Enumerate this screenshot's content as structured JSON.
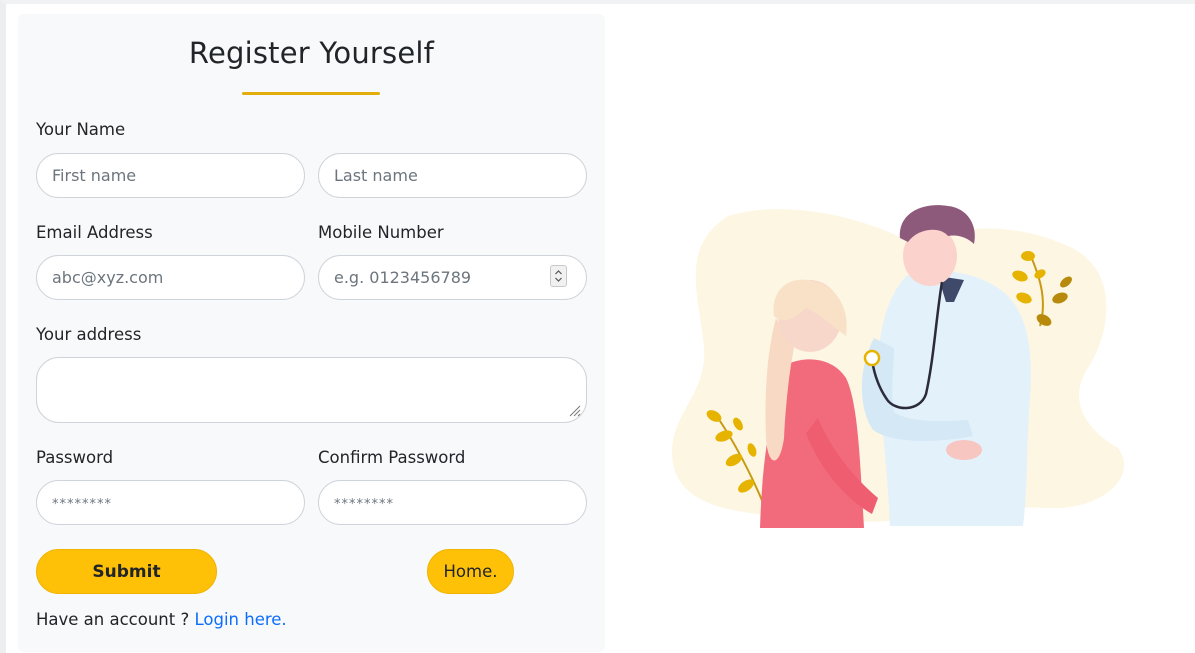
{
  "form": {
    "title": "Register Yourself",
    "name_label": "Your Name",
    "first_name_placeholder": "First name",
    "last_name_placeholder": "Last name",
    "email_label": "Email Address",
    "email_placeholder": "abc@xyz.com",
    "mobile_label": "Mobile Number",
    "mobile_placeholder": "e.g. 0123456789",
    "address_label": "Your address",
    "password_label": "Password",
    "password_placeholder": "********",
    "confirm_password_label": "Confirm Password",
    "confirm_password_placeholder": "********",
    "submit_label": "Submit",
    "home_label": "Home.",
    "account_prompt": "Have an account ? ",
    "login_link": "Login here."
  },
  "colors": {
    "accent": "#ffc107",
    "underline": "#e3ae0b",
    "link": "#0d6efd",
    "card_bg": "#f8f9fa"
  },
  "illustration": {
    "icon": "doctor-patient-illustration"
  }
}
